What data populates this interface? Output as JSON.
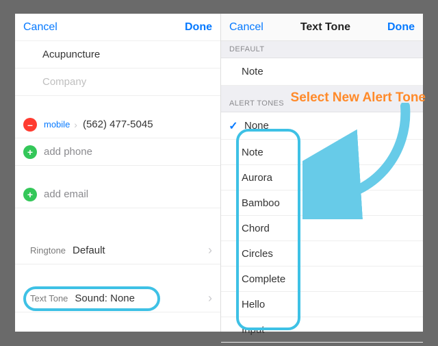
{
  "left": {
    "cancel": "Cancel",
    "done": "Done",
    "name": "Acupuncture",
    "company_placeholder": "Company",
    "phone_type": "mobile",
    "phone_value": "(562) 477-5045",
    "add_phone": "add phone",
    "add_email": "add email",
    "ringtone_label": "Ringtone",
    "ringtone_value": "Default",
    "texttone_label": "Text Tone",
    "texttone_value": "Sound: None"
  },
  "right": {
    "cancel": "Cancel",
    "title": "Text Tone",
    "done": "Done",
    "default_header": "DEFAULT",
    "default_value": "Note",
    "alert_header": "ALERT TONES",
    "selected": "None",
    "tones": [
      "Note",
      "Aurora",
      "Bamboo",
      "Chord",
      "Circles",
      "Complete",
      "Hello",
      "Input"
    ]
  },
  "annotation": {
    "callout": "Select New Alert Tone"
  }
}
